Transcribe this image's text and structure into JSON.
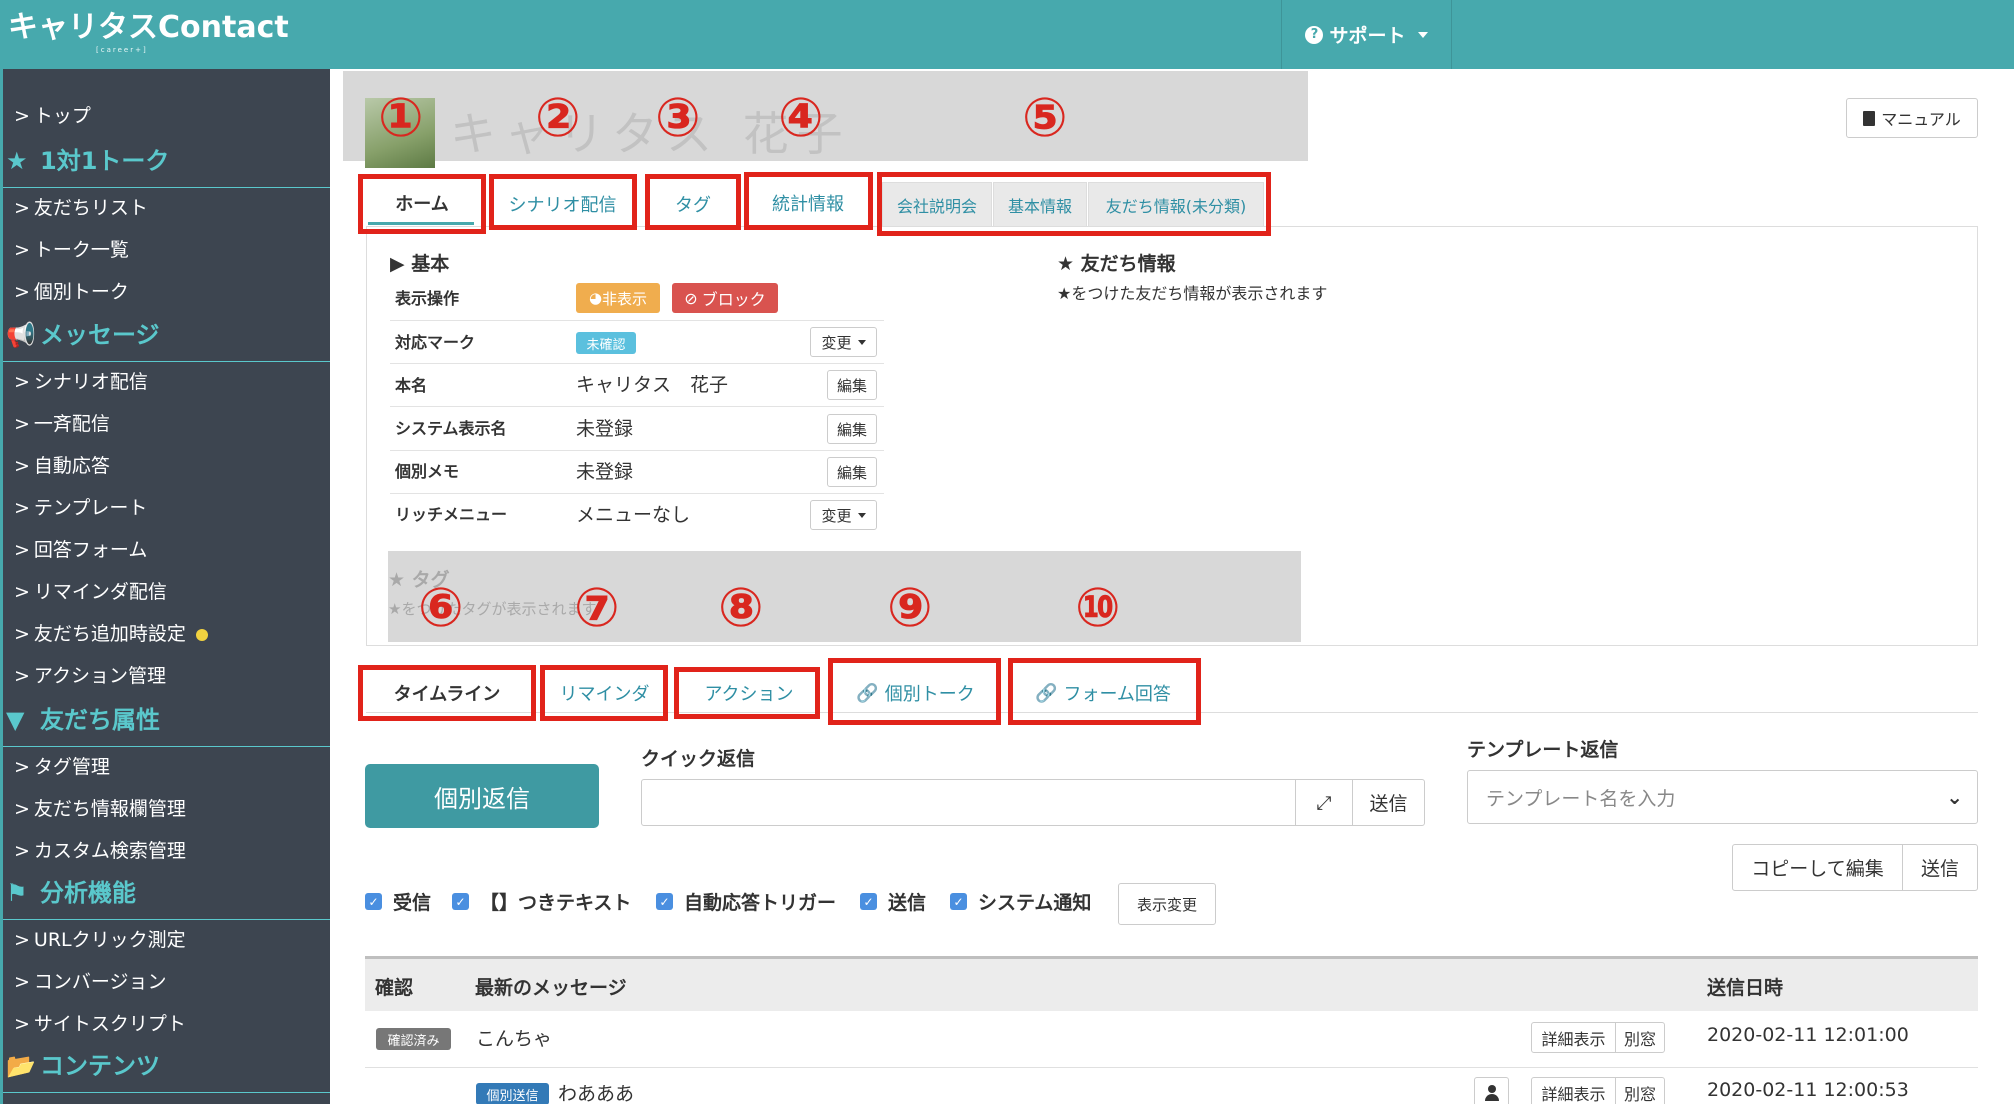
{
  "header": {
    "logo": "キャリタスContact",
    "logo_sub": "[career+]",
    "support": "サポート"
  },
  "sidebar": {
    "items": {
      "top": "トップ",
      "friends_list": "友だちリスト",
      "talk_list": "トーク一覧",
      "individual_talk": "個別トーク",
      "scenario": "シナリオ配信",
      "broadcast": "一斉配信",
      "auto_reply": "自動応答",
      "template": "テンプレート",
      "answer_form": "回答フォーム",
      "reminder": "リマインダ配信",
      "friend_add": "友だち追加時設定",
      "action_mgmt": "アクション管理",
      "tag_mgmt": "タグ管理",
      "friend_info_mgmt": "友だち情報欄管理",
      "custom_search": "カスタム検索管理",
      "url_click": "URLクリック測定",
      "conversion": "コンバージョン",
      "site_script": "サイトスクリプト"
    },
    "headings": {
      "one_on_one": "1対1トーク",
      "message": "メッセージ",
      "friend_attr": "友だち属性",
      "analytics": "分析機能",
      "contents": "コンテンツ"
    },
    "chevron": ">"
  },
  "profile": {
    "name_faded": "キャリタス 花子"
  },
  "manual_button": "マニュアル",
  "annotations": [
    "①",
    "②",
    "③",
    "④",
    "⑤",
    "⑥",
    "⑦",
    "⑧",
    "⑨",
    "⑩"
  ],
  "top_tabs": [
    "ホーム",
    "シナリオ配信",
    "タグ",
    "統計情報"
  ],
  "extra_tabs": [
    "会社説明会",
    "基本情報",
    "友だち情報(未分類)"
  ],
  "basic": {
    "title": "▶ 基本",
    "rows": [
      {
        "label": "表示操作"
      },
      {
        "label": "対応マーク"
      },
      {
        "label": "本名",
        "value": "キャリタス　花子"
      },
      {
        "label": "システム表示名",
        "value": "未登録"
      },
      {
        "label": "個別メモ",
        "value": "未登録"
      },
      {
        "label": "リッチメニュー",
        "value": "メニューなし"
      }
    ],
    "hide_badge": "非表示",
    "block_badge": "ブロック",
    "unconfirmed_badge": "未確認",
    "change": "変更",
    "edit": "編集"
  },
  "friend_info": {
    "title": "★ 友だち情報",
    "subtitle": "★をつけた友だち情報が表示されます"
  },
  "tag_section": {
    "title": "★ タグ",
    "subtitle": "★をつけたタグが表示されます"
  },
  "bottom_tabs": [
    "タイムライン",
    "リマインダ",
    "アクション",
    "個別トーク",
    "フォーム回答"
  ],
  "reply": {
    "individual_reply": "個別返信",
    "quick_reply_label": "クイック返信",
    "send": "送信",
    "template_label": "テンプレート返信",
    "template_placeholder": "テンプレート名を入力",
    "copy_edit": "コピーして編集"
  },
  "filters": [
    "受信",
    "【】つきテキスト",
    "自動応答トリガー",
    "送信",
    "システム通知"
  ],
  "display_change": "表示変更",
  "table": {
    "headers": [
      "確認",
      "最新のメッセージ",
      "送信日時"
    ],
    "detail": "詳細表示",
    "other_window": "別窓",
    "rows": [
      {
        "badge": "確認済み",
        "message": "こんちゃ",
        "datetime": "2020-02-11 12:01:00"
      },
      {
        "badge": "個別送信",
        "message": "わあああ",
        "datetime": "2020-02-11 12:00:53"
      }
    ]
  },
  "colors": {
    "brand": "#47a9ad",
    "sidebar_bg": "#3d4550",
    "annotation_red": "#e1231a",
    "link": "#2f8fa4"
  }
}
